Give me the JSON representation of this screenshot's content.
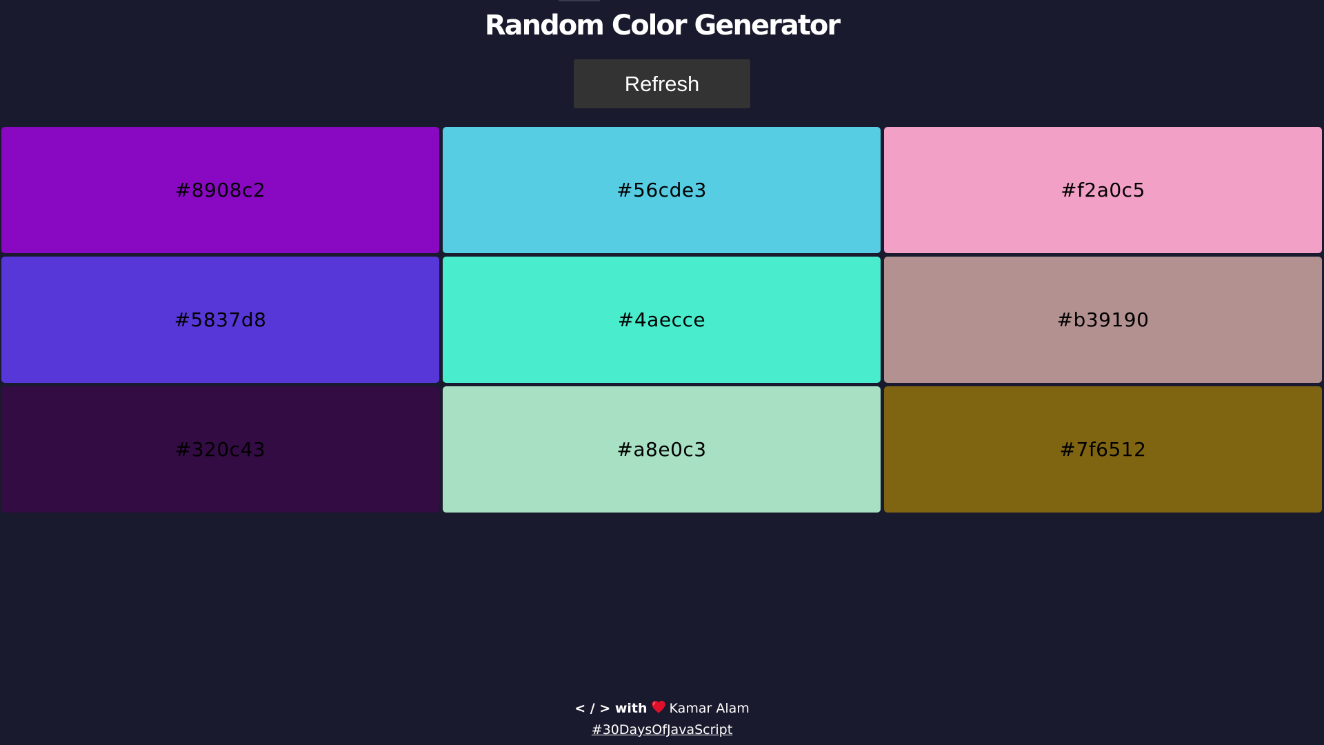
{
  "header": {
    "title": "Random Color Generator",
    "refresh_label": "Refresh"
  },
  "palette": {
    "swatches": [
      {
        "hex": "#8908c2",
        "label": "#8908c2"
      },
      {
        "hex": "#56cde3",
        "label": "#56cde3"
      },
      {
        "hex": "#f2a0c5",
        "label": "#f2a0c5"
      },
      {
        "hex": "#5837d8",
        "label": "#5837d8"
      },
      {
        "hex": "#4aecce",
        "label": "#4aecce"
      },
      {
        "hex": "#b39190",
        "label": "#b39190"
      },
      {
        "hex": "#320c43",
        "label": "#320c43"
      },
      {
        "hex": "#a8e0c3",
        "label": "#a8e0c3"
      },
      {
        "hex": "#7f6512",
        "label": "#7f6512"
      }
    ]
  },
  "footer": {
    "prefix": "< / > with",
    "heart_icon": "heart-icon",
    "author": "Kamar Alam",
    "hashtag": "#30DaysOfJavaScript"
  },
  "colors": {
    "background": "#1a1a2e",
    "button_bg": "#333333",
    "heart": "#e0102a"
  }
}
